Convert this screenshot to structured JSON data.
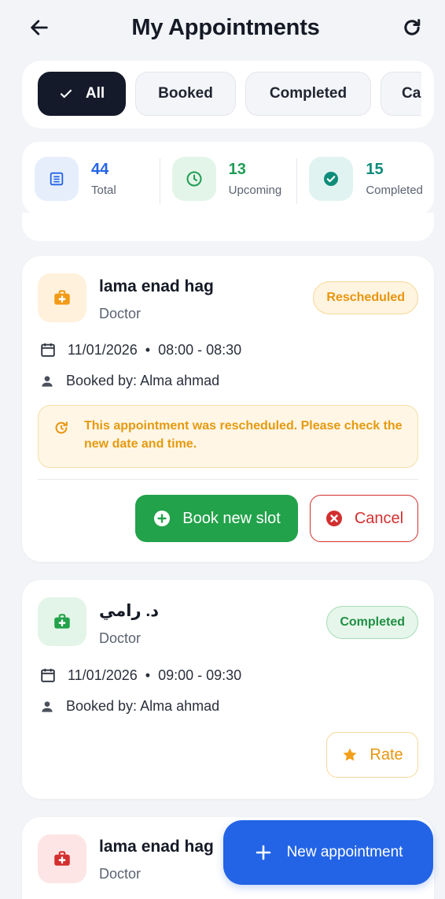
{
  "header": {
    "title": "My Appointments",
    "back_icon": "arrow-left-icon",
    "refresh_icon": "refresh-icon"
  },
  "filters": [
    {
      "label": "All",
      "active": true
    },
    {
      "label": "Booked",
      "active": false
    },
    {
      "label": "Completed",
      "active": false
    },
    {
      "label": "Ca",
      "active": false
    }
  ],
  "stats": [
    {
      "value": "44",
      "label": "Total",
      "color": "#2364e6",
      "bg": "#e6eefc",
      "icon": "list-icon"
    },
    {
      "value": "13",
      "label": "Upcoming",
      "color": "#1f9d55",
      "bg": "#e3f5e8",
      "icon": "clock-icon"
    },
    {
      "value": "15",
      "label": "Completed",
      "color": "#0f8c7a",
      "bg": "#e0f3f0",
      "icon": "check-circle-icon"
    }
  ],
  "appointments": [
    {
      "name": "lama enad hag",
      "role": "Doctor",
      "status": "Rescheduled",
      "date": "11/01/2026",
      "time": "08:00 - 08:30",
      "booked_by": "Booked by: Alma ahmad",
      "notice": "This appointment was rescheduled. Please check the new date and time.",
      "actions": {
        "book": "Book new slot",
        "cancel": "Cancel"
      }
    },
    {
      "name": "د. رامي",
      "role": "Doctor",
      "status": "Completed",
      "date": "11/01/2026",
      "time": "09:00 - 09:30",
      "booked_by": "Booked by: Alma ahmad",
      "actions": {
        "rate": "Rate"
      }
    },
    {
      "name": "lama enad hag",
      "role": "Doctor"
    }
  ],
  "fab": {
    "label": "New appointment"
  },
  "colors": {
    "primary": "#2364e6",
    "success": "#22a24a",
    "danger": "#d32f2f",
    "warning": "#f2a01b",
    "dark": "#141a2a"
  }
}
